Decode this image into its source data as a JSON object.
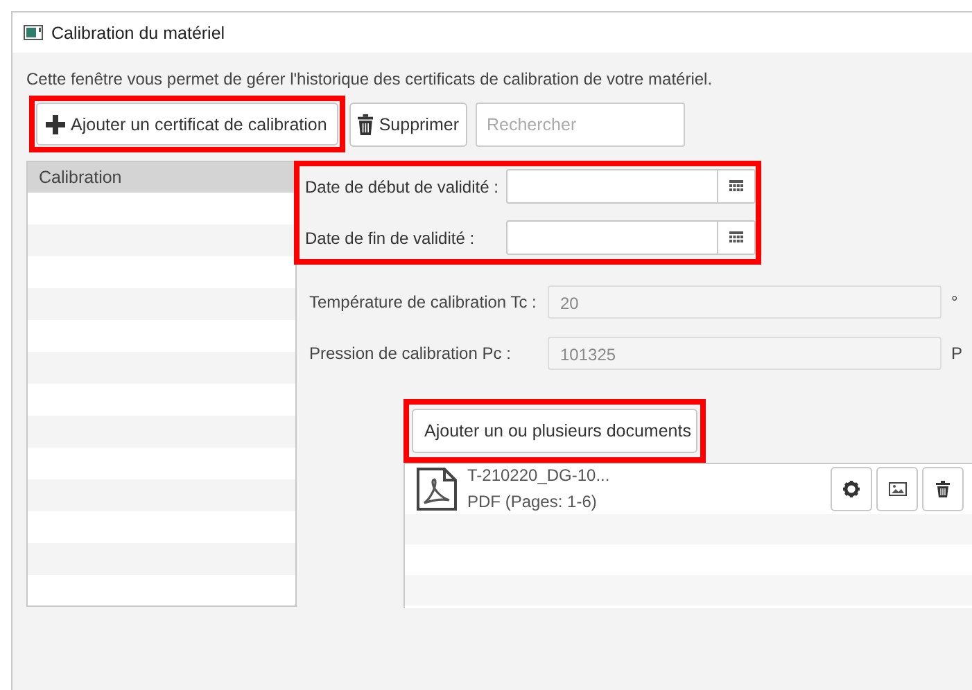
{
  "window": {
    "title": "Calibration du matériel"
  },
  "description": "Cette fenêtre vous permet de gérer l'historique des certificats de calibration de votre matériel.",
  "toolbar": {
    "add_button": "Ajouter un certificat de calibration",
    "delete_button": "Supprimer",
    "search": {
      "placeholder": "Rechercher"
    }
  },
  "calibration_list": {
    "header": "Calibration"
  },
  "dates": [
    {
      "label": "Date de début de validité :"
    },
    {
      "label": "Date de fin de validité :"
    }
  ],
  "conditions": [
    {
      "label": "Température de calibration Tc :",
      "value": "20",
      "unit": "°"
    },
    {
      "label": "Pression de calibration Pc :",
      "value": "101325",
      "unit": "P"
    }
  ],
  "documents": {
    "add_button": "Ajouter un ou plusieurs documents",
    "items": [
      {
        "name": "T-210220_DG-10...",
        "details": "PDF (Pages: 1-6)"
      }
    ]
  }
}
